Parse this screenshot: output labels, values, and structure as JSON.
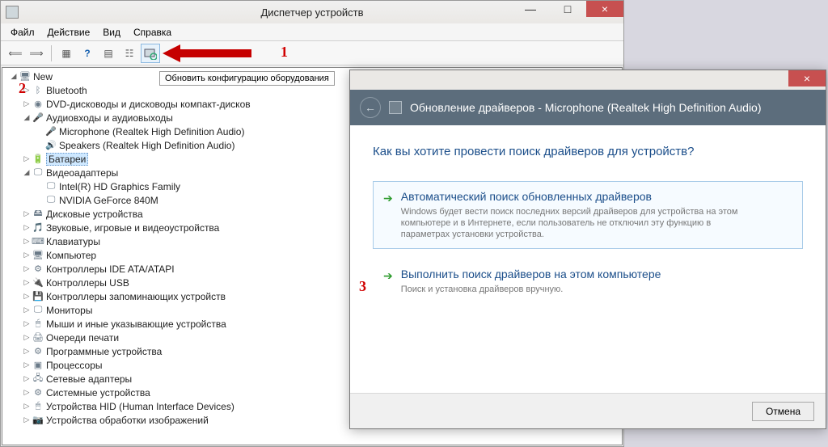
{
  "window": {
    "title": "Диспетчер устройств",
    "minimize": "—",
    "maximize": "□",
    "close": "×"
  },
  "menubar": [
    "Файл",
    "Действие",
    "Вид",
    "Справка"
  ],
  "toolbar": {
    "tooltip": "Обновить конфигурацию оборудования"
  },
  "markers": {
    "m1": "1",
    "m2": "2",
    "m3": "3"
  },
  "tree": [
    {
      "depth": 0,
      "exp": "◢",
      "icon": "pc",
      "label": "New"
    },
    {
      "depth": 1,
      "exp": "▷",
      "icon": "bt",
      "label": "Bluetooth"
    },
    {
      "depth": 1,
      "exp": "▷",
      "icon": "dvd",
      "label": "DVD-дисководы и дисководы компакт-дисков"
    },
    {
      "depth": 1,
      "exp": "◢",
      "icon": "audio",
      "label": "Аудиовходы и аудиовыходы"
    },
    {
      "depth": 2,
      "exp": "",
      "icon": "mic",
      "label": "Microphone (Realtek High Definition Audio)"
    },
    {
      "depth": 2,
      "exp": "",
      "icon": "spk",
      "label": "Speakers (Realtek High Definition Audio)"
    },
    {
      "depth": 1,
      "exp": "▷",
      "icon": "bat",
      "label": "Батареи",
      "selected": true
    },
    {
      "depth": 1,
      "exp": "◢",
      "icon": "disp",
      "label": "Видеоадаптеры"
    },
    {
      "depth": 2,
      "exp": "",
      "icon": "gpu",
      "label": "Intel(R) HD Graphics Family"
    },
    {
      "depth": 2,
      "exp": "",
      "icon": "gpu",
      "label": "NVIDIA GeForce 840M"
    },
    {
      "depth": 1,
      "exp": "▷",
      "icon": "hdd",
      "label": "Дисковые устройства"
    },
    {
      "depth": 1,
      "exp": "▷",
      "icon": "snd",
      "label": "Звуковые, игровые и видеоустройства"
    },
    {
      "depth": 1,
      "exp": "▷",
      "icon": "kb",
      "label": "Клавиатуры"
    },
    {
      "depth": 1,
      "exp": "▷",
      "icon": "pc",
      "label": "Компьютер"
    },
    {
      "depth": 1,
      "exp": "▷",
      "icon": "ide",
      "label": "Контроллеры IDE ATA/ATAPI"
    },
    {
      "depth": 1,
      "exp": "▷",
      "icon": "usb",
      "label": "Контроллеры USB"
    },
    {
      "depth": 1,
      "exp": "▷",
      "icon": "stor",
      "label": "Контроллеры запоминающих устройств"
    },
    {
      "depth": 1,
      "exp": "▷",
      "icon": "mon",
      "label": "Мониторы"
    },
    {
      "depth": 1,
      "exp": "▷",
      "icon": "mouse",
      "label": "Мыши и иные указывающие устройства"
    },
    {
      "depth": 1,
      "exp": "▷",
      "icon": "print",
      "label": "Очереди печати"
    },
    {
      "depth": 1,
      "exp": "▷",
      "icon": "sw",
      "label": "Программные устройства"
    },
    {
      "depth": 1,
      "exp": "▷",
      "icon": "cpu",
      "label": "Процессоры"
    },
    {
      "depth": 1,
      "exp": "▷",
      "icon": "net",
      "label": "Сетевые адаптеры"
    },
    {
      "depth": 1,
      "exp": "▷",
      "icon": "sys",
      "label": "Системные устройства"
    },
    {
      "depth": 1,
      "exp": "▷",
      "icon": "hid",
      "label": "Устройства HID (Human Interface Devices)"
    },
    {
      "depth": 1,
      "exp": "▷",
      "icon": "img",
      "label": "Устройства обработки изображений"
    }
  ],
  "dialog": {
    "title": "Обновление драйверов - Microphone (Realtek High Definition Audio)",
    "question": "Как вы хотите провести поиск драйверов для устройств?",
    "opt1": {
      "title": "Автоматический поиск обновленных драйверов",
      "desc": "Windows будет вести поиск последних версий драйверов для устройства на этом компьютере и в Интернете, если пользователь не отключил эту функцию в параметрах установки устройства."
    },
    "opt2": {
      "title": "Выполнить поиск драйверов на этом компьютере",
      "desc": "Поиск и установка драйверов вручную."
    },
    "cancel": "Отмена",
    "close": "×"
  }
}
